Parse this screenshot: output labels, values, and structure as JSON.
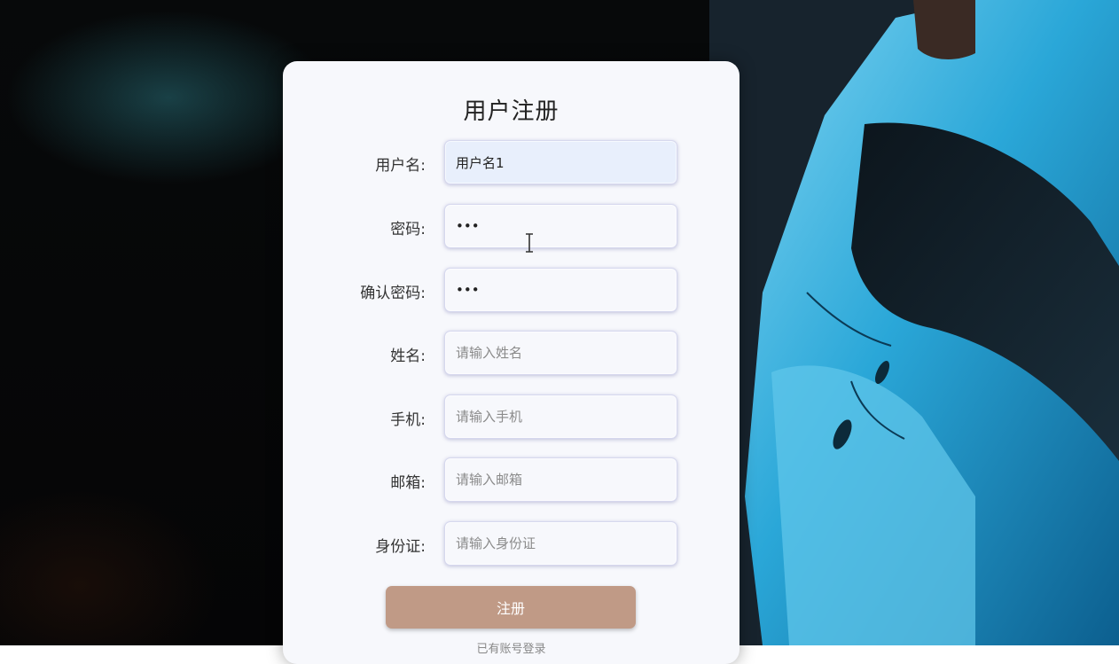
{
  "form": {
    "title": "用户注册",
    "fields": [
      {
        "label": "用户名:",
        "value": "用户名1",
        "placeholder": "",
        "type": "text"
      },
      {
        "label": "密码:",
        "value": "•••",
        "placeholder": "",
        "type": "password"
      },
      {
        "label": "确认密码:",
        "value": "•••",
        "placeholder": "",
        "type": "password"
      },
      {
        "label": "姓名:",
        "value": "",
        "placeholder": "请输入姓名",
        "type": "text"
      },
      {
        "label": "手机:",
        "value": "",
        "placeholder": "请输入手机",
        "type": "text"
      },
      {
        "label": "邮箱:",
        "value": "",
        "placeholder": "请输入邮箱",
        "type": "text"
      },
      {
        "label": "身份证:",
        "value": "",
        "placeholder": "请输入身份证",
        "type": "text"
      }
    ],
    "submit_label": "注册",
    "login_link": "已有账号登录"
  },
  "icons": {
    "cursor": "text-cursor-icon"
  },
  "colors": {
    "submit_button": "#c09a86",
    "card_background": "#f7f8fc"
  }
}
